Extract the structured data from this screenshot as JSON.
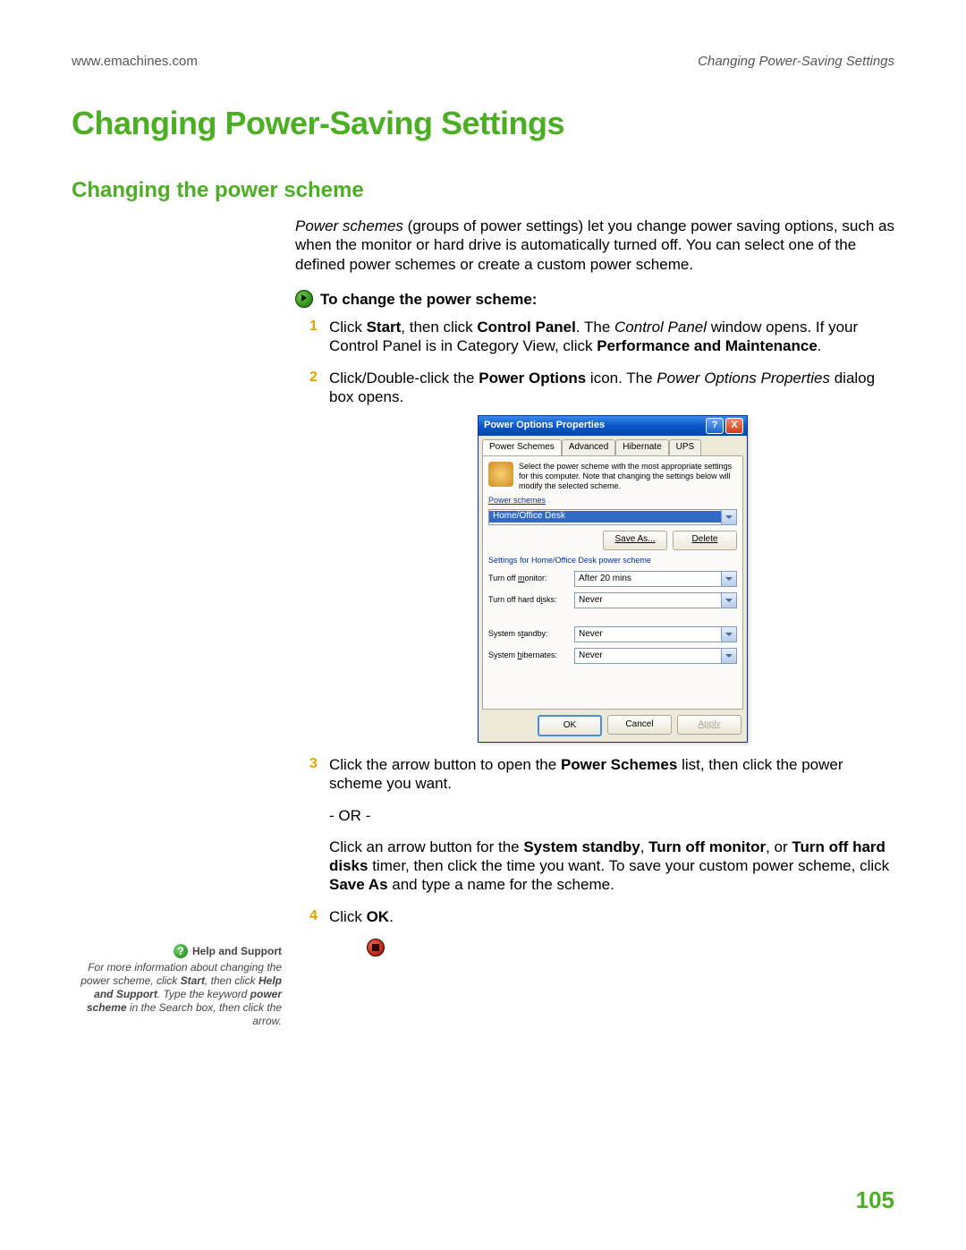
{
  "header": {
    "url": "www.emachines.com",
    "section": "Changing Power-Saving Settings"
  },
  "title": "Changing Power-Saving Settings",
  "subtitle": "Changing the power scheme",
  "intro": {
    "lead_italic": "Power schemes",
    "rest": " (groups of power settings) let you change power saving options, such as when the monitor or hard drive is automatically turned off. You can select one of the defined power schemes or create a custom power scheme."
  },
  "task_header": "To change the power scheme:",
  "steps": {
    "s1_pre": "Click ",
    "s1_b1": "Start",
    "s1_mid1": ", then click ",
    "s1_b2": "Control Panel",
    "s1_mid2": ". The ",
    "s1_i1": "Control Panel",
    "s1_mid3": " window opens. If your Control Panel is in Category View, click ",
    "s1_b3": "Performance and Maintenance",
    "s1_end": ".",
    "s2_pre": "Click/Double-click the ",
    "s2_b1": "Power Options",
    "s2_mid1": " icon. The ",
    "s2_i1": "Power Options Properties",
    "s2_end": " dialog box opens.",
    "s3_pre": "Click the arrow button to open the ",
    "s3_b1": "Power Schemes",
    "s3_end": " list, then click the power scheme you want.",
    "or": "- OR -",
    "s3b_pre": "Click an arrow button for the ",
    "s3b_b1": "System standby",
    "s3b_c1": ", ",
    "s3b_b2": "Turn off monitor",
    "s3b_c2": ", or ",
    "s3b_b3": "Turn off hard disks",
    "s3b_mid": " timer, then click the time you want. To save your custom power scheme, click ",
    "s3b_b4": "Save As",
    "s3b_end": " and type a name for the scheme.",
    "s4_pre": "Click ",
    "s4_b1": "OK",
    "s4_end": "."
  },
  "dialog": {
    "title": "Power Options Properties",
    "tabs": [
      "Power Schemes",
      "Advanced",
      "Hibernate",
      "UPS"
    ],
    "desc": "Select the power scheme with the most appropriate settings for this computer. Note that changing the settings below will modify the selected scheme.",
    "group1_label": "Power schemes",
    "scheme_value": "Home/Office Desk",
    "save_as": "Save As...",
    "delete": "Delete",
    "group2_label": "Settings for Home/Office Desk power scheme",
    "fields": [
      {
        "label": "Turn off monitor:",
        "value": "After 20 mins"
      },
      {
        "label": "Turn off hard disks:",
        "value": "Never"
      },
      {
        "label": "System standby:",
        "value": "Never"
      },
      {
        "label": "System hibernates:",
        "value": "Never"
      }
    ],
    "ok": "OK",
    "cancel": "Cancel",
    "apply": "Apply"
  },
  "help": {
    "title": "Help and Support",
    "l1": "For more information about changing the power scheme, click ",
    "b1": "Start",
    "l2": ", then click ",
    "b2": "Help and Support",
    "l3": ". Type the keyword ",
    "b3": "power scheme",
    "l4": " in the Search box, then click the arrow."
  },
  "page_number": "105"
}
